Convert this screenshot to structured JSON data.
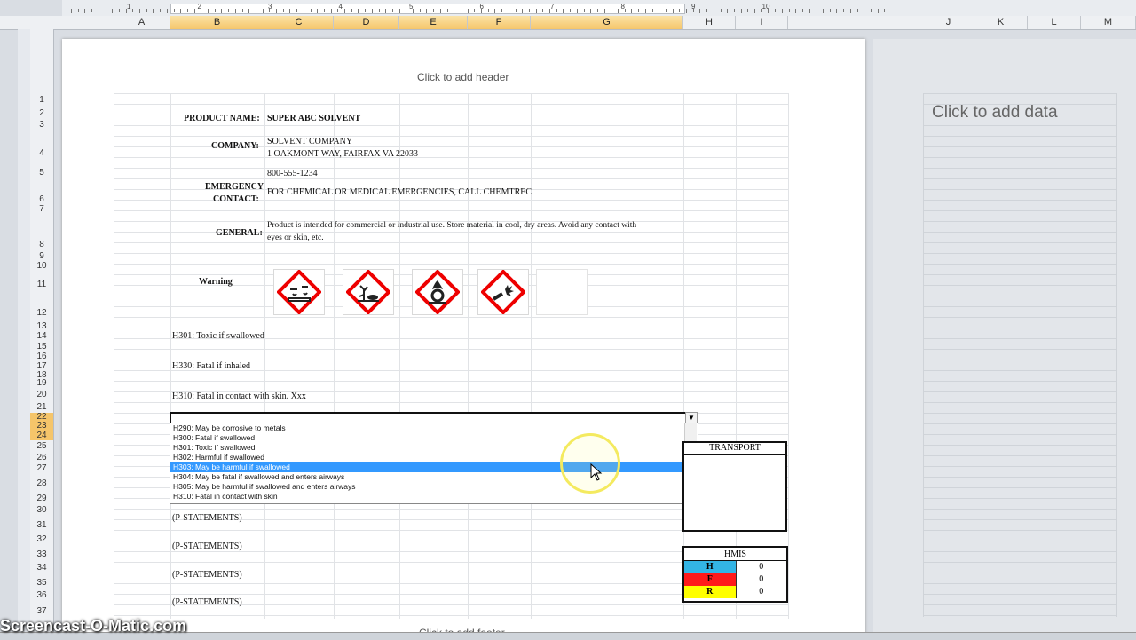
{
  "ruler": {
    "numbers": [
      "1",
      "2",
      "3",
      "4",
      "5",
      "6",
      "7",
      "8",
      "9",
      "10"
    ]
  },
  "columns": [
    "A",
    "B",
    "C",
    "D",
    "E",
    "F",
    "G",
    "H",
    "I",
    "J",
    "K",
    "L",
    "M"
  ],
  "rows": [
    "1",
    "2",
    "3",
    "4",
    "5",
    "6",
    "7",
    "8",
    "9",
    "10",
    "11",
    "12",
    "13",
    "14",
    "15",
    "16",
    "17",
    "18",
    "19",
    "20",
    "21",
    "22",
    "23",
    "24",
    "25",
    "26",
    "27",
    "28",
    "29",
    "30",
    "31",
    "32",
    "33",
    "34",
    "35",
    "36",
    "37"
  ],
  "header_placeholder": "Click to add header",
  "footer_placeholder": "Click to add footer",
  "data_placeholder": "Click to add data",
  "sheet": {
    "product_name_label": "PRODUCT NAME:",
    "product_name": "SUPER ABC SOLVENT",
    "company_label": "COMPANY:",
    "company_line1": "SOLVENT COMPANY",
    "company_line2": "1 OAKMONT WAY, FAIRFAX VA 22033",
    "phone": "800-555-1234",
    "emergency_label_1": "EMERGENCY",
    "emergency_label_2": "CONTACT:",
    "emergency_text": "FOR CHEMICAL OR MEDICAL EMERGENCIES, CALL CHEMTREC",
    "general_label": "GENERAL:",
    "general_line1": "Product is intended for commercial or industrial use.  Store material in cool, dry areas.  Avoid any contact with",
    "general_line2": "eyes or skin, etc.",
    "warning_label": "Warning",
    "pictogram_icons": [
      "corrosion-icon",
      "environment-icon",
      "oxidizer-icon",
      "explosive-icon"
    ],
    "h_statements": [
      "H301: Toxic if swallowed",
      "H330: Fatal if inhaled",
      "H310: Fatal in contact with skin. Xxx"
    ],
    "p_statements": [
      "(P-STATEMENTS)",
      "(P-STATEMENTS)",
      "(P-STATEMENTS)",
      "(P-STATEMENTS)"
    ]
  },
  "dropdown": {
    "options": [
      "H290: May be corrosive to metals",
      "H300: Fatal if swallowed",
      "H301: Toxic if swallowed",
      "H302: Harmful if swallowed",
      "H303: May be harmful if swallowed",
      "H304: May be fatal if swallowed and enters airways",
      "H305: May be harmful if swallowed and enters airways",
      "H310: Fatal in contact with skin"
    ],
    "highlighted_index": 4
  },
  "transport": {
    "title": "TRANSPORT"
  },
  "hmis": {
    "title": "HMIS",
    "rows": [
      {
        "label": "H",
        "value": "0",
        "color": "#33b5e5"
      },
      {
        "label": "F",
        "value": "0",
        "color": "#ff1a1a"
      },
      {
        "label": "R",
        "value": "0",
        "color": "#ffff00"
      }
    ]
  },
  "watermark": "Screencast-O-Matic.com"
}
